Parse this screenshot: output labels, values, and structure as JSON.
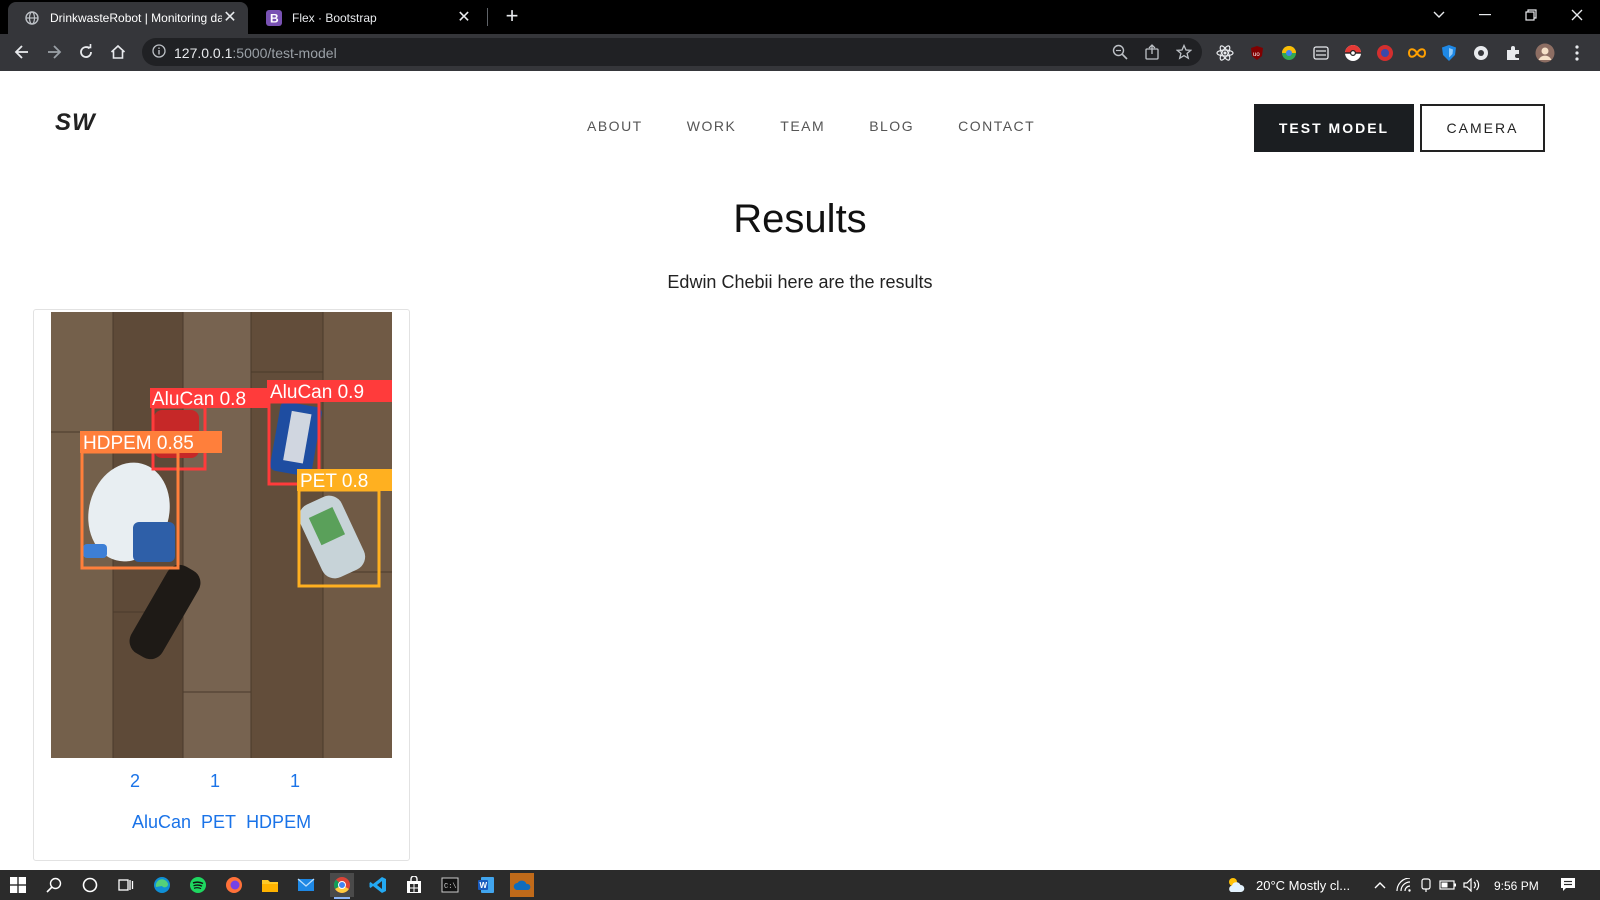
{
  "browser": {
    "tabs": [
      {
        "title": "DrinkwasteRobot | Monitoring da",
        "active": true
      },
      {
        "title": "Flex · Bootstrap",
        "active": false
      }
    ],
    "url_host": "127.0.0.1",
    "url_path": ":5000/test-model"
  },
  "site": {
    "brand": "SW",
    "nav": [
      "ABOUT",
      "WORK",
      "TEAM",
      "BLOG",
      "CONTACT"
    ],
    "buttons": {
      "test_model": "TEST MODEL",
      "camera": "CAMERA"
    }
  },
  "results": {
    "title": "Results",
    "subtitle": "Edwin Chebii here are the results",
    "detections": [
      {
        "label": "AluCan 0.8",
        "color": "#ff3b3b"
      },
      {
        "label": "AluCan 0.9",
        "color": "#ff3b3b"
      },
      {
        "label": "HDPEM 0.85",
        "color": "#ff7f3b"
      },
      {
        "label": "PET 0.8",
        "color": "#ffb020"
      }
    ],
    "counts": [
      "2",
      "1",
      "1"
    ],
    "classes": [
      "AluCan",
      "PET",
      "HDPEM"
    ]
  },
  "taskbar": {
    "weather": "20°C  Mostly cl...",
    "time": "9:56 PM"
  }
}
